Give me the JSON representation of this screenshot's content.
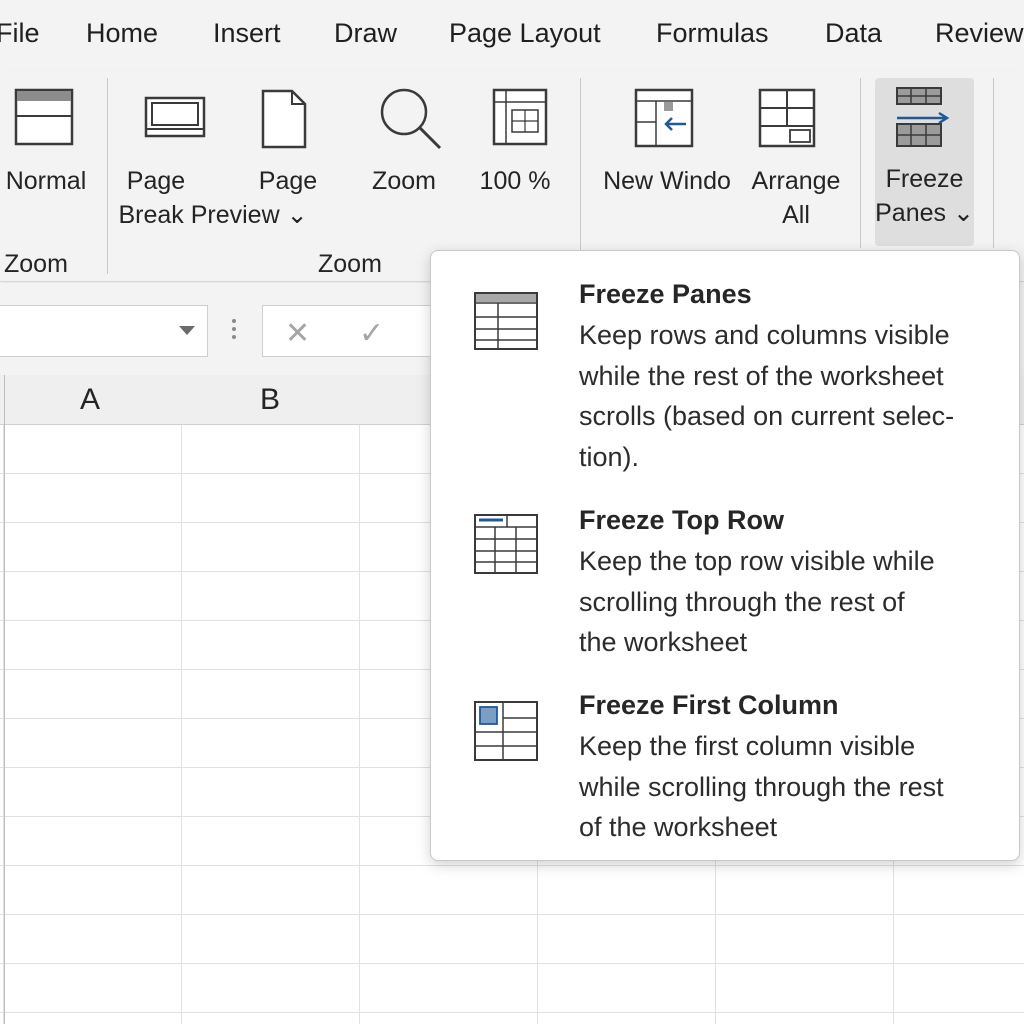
{
  "menu": {
    "tabs": [
      "File",
      "Home",
      "Insert",
      "Draw",
      "Page Layout",
      "Formulas",
      "Data",
      "Review"
    ]
  },
  "ribbon": {
    "normal": "Normal",
    "page_break_line1": "Page",
    "page_break_line2": "Break Preview ⌄",
    "page_layout": "Page",
    "zoom": "Zoom",
    "zoom_100": "100 %",
    "new_window": "New Windo",
    "arrange_line1": "Arrange",
    "arrange_line2": "All",
    "freeze_line1": "Freeze",
    "freeze_line2": "Panes ⌄",
    "group_left": "Zoom",
    "group_zoom": "Zoom"
  },
  "formula_bar": {
    "cancel_icon": "✕",
    "enter_icon": "✓"
  },
  "columns": [
    "A",
    "B"
  ],
  "freeze_menu": {
    "items": [
      {
        "title": "Freeze Panes",
        "desc_lines": [
          "Keep rows and columns visible",
          "while the rest of the worksheet",
          "scrolls (based on current selec-",
          "tion)."
        ]
      },
      {
        "title": "Freeze Top Row",
        "desc_lines": [
          "Keep the top row visible while",
          "scrolling through the rest of",
          "the worksheet"
        ]
      },
      {
        "title": "Freeze First Column",
        "desc_lines": [
          "Keep the first column  visible",
          "while scrolling through the rest",
          "of the worksheet"
        ]
      }
    ]
  },
  "colors": {
    "accent": "#1f5a96",
    "cell_highlight": "#7b9fc4",
    "freeze_button_bg": "#dedede"
  }
}
